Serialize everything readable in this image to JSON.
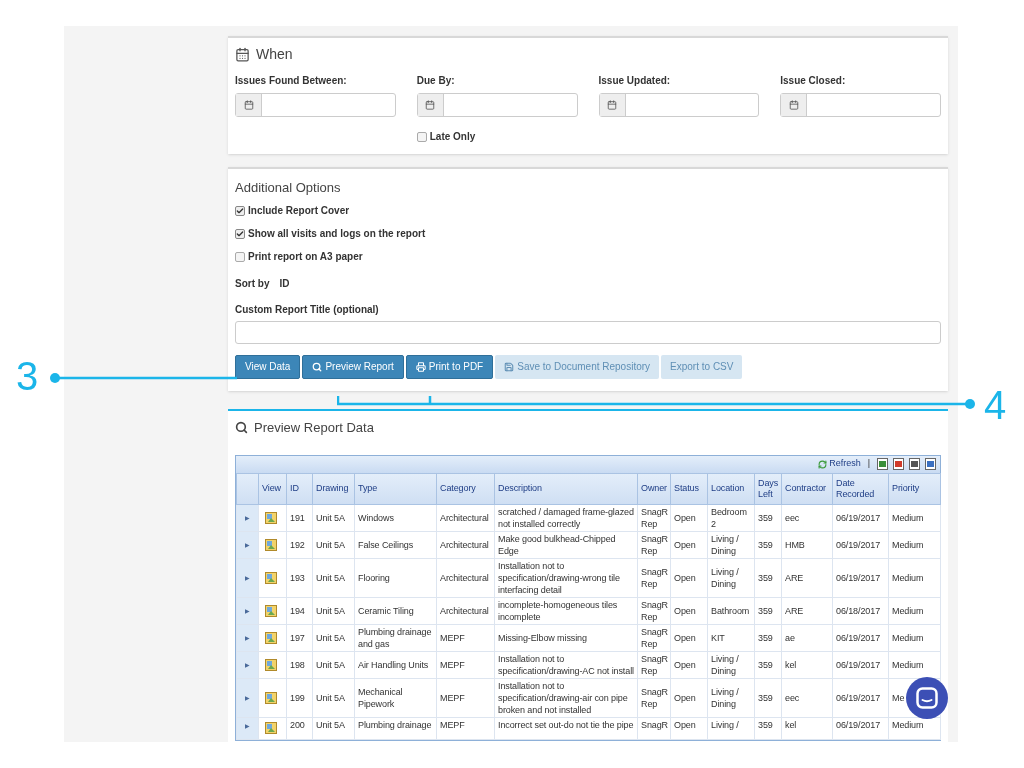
{
  "when": {
    "title": "When",
    "fields": [
      {
        "label": "Issues Found Between:"
      },
      {
        "label": "Due By:"
      },
      {
        "label": "Issue Updated:"
      },
      {
        "label": "Issue Closed:"
      }
    ],
    "late_only": {
      "label": "Late Only",
      "checked": false
    }
  },
  "options": {
    "title": "Additional Options",
    "checkboxes": [
      {
        "label": "Include Report Cover",
        "checked": true
      },
      {
        "label": "Show all visits and logs on the report",
        "checked": true
      },
      {
        "label": "Print report on A3 paper",
        "checked": false
      }
    ],
    "sort": {
      "label": "Sort by",
      "value": "ID"
    },
    "custom_title": {
      "label": "Custom Report Title (optional)"
    },
    "buttons": [
      {
        "label": "View Data",
        "kind": "plain",
        "disabled": false
      },
      {
        "label": "Preview Report",
        "kind": "search",
        "disabled": false
      },
      {
        "label": "Print to PDF",
        "kind": "print",
        "disabled": false
      },
      {
        "label": "Save to Document Repository",
        "kind": "save",
        "disabled": true
      },
      {
        "label": "Export to CSV",
        "kind": "plain",
        "disabled": true
      }
    ]
  },
  "preview": {
    "title": "Preview Report Data",
    "refresh": "Refresh",
    "separator": "|",
    "columns": [
      "",
      "View",
      "ID",
      "Drawing",
      "Type",
      "Category",
      "Description",
      "Owner",
      "Status",
      "Location",
      "Days Left",
      "Contractor",
      "Date Recorded",
      "Priority"
    ],
    "rows": [
      {
        "cells": [
          "▶",
          "",
          "191",
          "Unit 5A",
          "Windows",
          "Architectural",
          "scratched / damaged frame-glazed not installed correctly",
          "SnagR Rep",
          "Open",
          "Bedroom 2",
          "359",
          "eec",
          "06/19/2017",
          "Medium"
        ]
      },
      {
        "cells": [
          "▶",
          "",
          "192",
          "Unit 5A",
          "False Ceilings",
          "Architectural",
          "Make good bulkhead-Chipped Edge",
          "SnagR Rep",
          "Open",
          "Living / Dining",
          "359",
          "HMB",
          "06/19/2017",
          "Medium"
        ]
      },
      {
        "cells": [
          "▶",
          "",
          "193",
          "Unit 5A",
          "Flooring",
          "Architectural",
          "Installation not to specification/drawing-wrong tile interfacing detail",
          "SnagR Rep",
          "Open",
          "Living / Dining",
          "359",
          "ARE",
          "06/19/2017",
          "Medium"
        ]
      },
      {
        "cells": [
          "▶",
          "",
          "194",
          "Unit 5A",
          "Ceramic Tiling",
          "Architectural",
          "incomplete-homogeneous tiles incomplete",
          "SnagR Rep",
          "Open",
          "Bathroom",
          "359",
          "ARE",
          "06/18/2017",
          "Medium"
        ]
      },
      {
        "cells": [
          "▶",
          "",
          "197",
          "Unit 5A",
          "Plumbing drainage and gas",
          "MEPF",
          "Missing-Elbow missing",
          "SnagR Rep",
          "Open",
          "KIT",
          "359",
          "ae",
          "06/19/2017",
          "Medium"
        ]
      },
      {
        "cells": [
          "▶",
          "",
          "198",
          "Unit 5A",
          "Air Handling Units",
          "MEPF",
          "Installation not to specification/drawing-AC not install",
          "SnagR Rep",
          "Open",
          "Living / Dining",
          "359",
          "kel",
          "06/19/2017",
          "Medium"
        ]
      },
      {
        "cells": [
          "▶",
          "",
          "199",
          "Unit 5A",
          "Mechanical Pipework",
          "MEPF",
          "Installation not to specification/drawing-air con pipe broken and not installed",
          "SnagR Rep",
          "Open",
          "Living / Dining",
          "359",
          "eec",
          "06/19/2017",
          "Me"
        ]
      },
      {
        "cells": [
          "▶",
          "",
          "200",
          "Unit 5A",
          "Plumbing drainage",
          "MEPF",
          "Incorrect set out-do not tie the pipe",
          "SnagR",
          "Open",
          "Living /",
          "359",
          "kel",
          "06/19/2017",
          "Medium"
        ]
      }
    ]
  },
  "annotations": [
    {
      "label": "3"
    },
    {
      "label": "4"
    }
  ]
}
